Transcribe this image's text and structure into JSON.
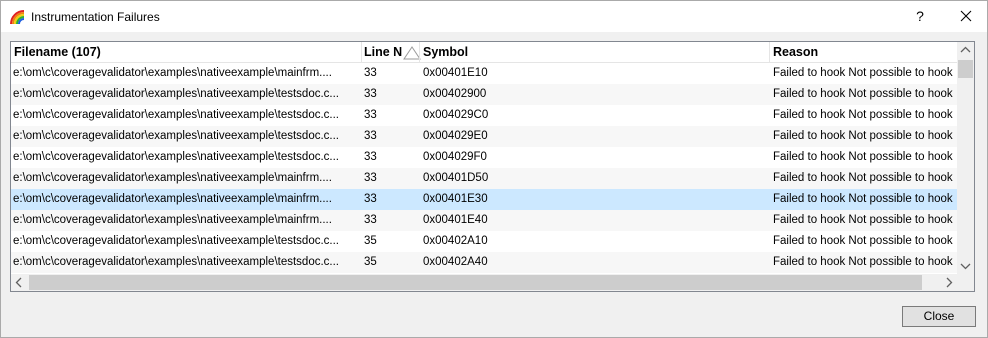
{
  "window": {
    "title": "Instrumentation Failures",
    "help_glyph": "?",
    "icons": [
      "app-rainbow-icon",
      "close-icon"
    ]
  },
  "table": {
    "columns": {
      "filename": "Filename (107)",
      "line": "Line N",
      "symbol": "Symbol",
      "reason": "Reason"
    },
    "sort": {
      "column": "line",
      "direction": "ascending"
    },
    "rows": [
      {
        "file": "e:\\om\\c\\coveragevalidator\\examples\\nativeexample\\mainfrm....",
        "line": "33",
        "symbol": "0x00401E10",
        "reason": "Failed to hook Not possible to hook"
      },
      {
        "file": "e:\\om\\c\\coveragevalidator\\examples\\nativeexample\\testsdoc.c...",
        "line": "33",
        "symbol": "0x00402900",
        "reason": "Failed to hook Not possible to hook"
      },
      {
        "file": "e:\\om\\c\\coveragevalidator\\examples\\nativeexample\\testsdoc.c...",
        "line": "33",
        "symbol": "0x004029C0",
        "reason": "Failed to hook Not possible to hook"
      },
      {
        "file": "e:\\om\\c\\coveragevalidator\\examples\\nativeexample\\testsdoc.c...",
        "line": "33",
        "symbol": "0x004029E0",
        "reason": "Failed to hook Not possible to hook"
      },
      {
        "file": "e:\\om\\c\\coveragevalidator\\examples\\nativeexample\\testsdoc.c...",
        "line": "33",
        "symbol": "0x004029F0",
        "reason": "Failed to hook Not possible to hook"
      },
      {
        "file": "e:\\om\\c\\coveragevalidator\\examples\\nativeexample\\mainfrm....",
        "line": "33",
        "symbol": "0x00401D50",
        "reason": "Failed to hook Not possible to hook"
      },
      {
        "file": "e:\\om\\c\\coveragevalidator\\examples\\nativeexample\\mainfrm....",
        "line": "33",
        "symbol": "0x00401E30",
        "reason": "Failed to hook Not possible to hook",
        "selected": true
      },
      {
        "file": "e:\\om\\c\\coveragevalidator\\examples\\nativeexample\\mainfrm....",
        "line": "33",
        "symbol": "0x00401E40",
        "reason": "Failed to hook Not possible to hook"
      },
      {
        "file": "e:\\om\\c\\coveragevalidator\\examples\\nativeexample\\testsdoc.c...",
        "line": "35",
        "symbol": "0x00402A10",
        "reason": "Failed to hook Not possible to hook"
      },
      {
        "file": "e:\\om\\c\\coveragevalidator\\examples\\nativeexample\\testsdoc.c...",
        "line": "35",
        "symbol": "0x00402A40",
        "reason": "Failed to hook Not possible to hook"
      }
    ]
  },
  "footer": {
    "close_label": "Close"
  },
  "colors": {
    "selected_row": "#cce8ff",
    "alt_row": "#f7f7f7",
    "dialog_bg": "#f0f0f0"
  }
}
